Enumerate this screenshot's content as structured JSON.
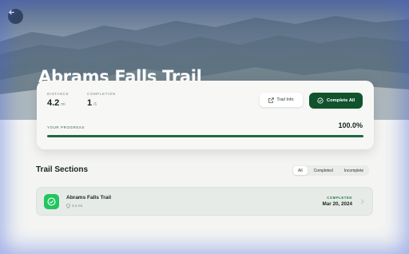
{
  "hero": {
    "title": "Abrams Falls Trail"
  },
  "stats": {
    "distance_label": "DISTANCE",
    "distance_value": "4.2",
    "distance_unit": "mi",
    "completion_label": "COMPLETION",
    "completion_value": "1",
    "completion_total": "/1"
  },
  "actions": {
    "trail_info_label": "Trail Info",
    "complete_all_label": "Complete All"
  },
  "progress": {
    "label": "YOUR PROGRESS",
    "value_text": "100.0%",
    "fraction": 1.0
  },
  "sections": {
    "title": "Trail Sections",
    "filters": [
      "All",
      "Completed",
      "Incomplete"
    ],
    "active_filter": "All",
    "items": [
      {
        "name": "Abrams Falls Trail",
        "distance": "4.2 mi",
        "status": "COMPLETED",
        "date": "Mar 20, 2024"
      }
    ]
  },
  "colors": {
    "primary": "#11532c",
    "accent_green": "#22c55e",
    "progress_fill": "#1d6b3c"
  },
  "icons": {
    "back": "arrow-left-icon",
    "trail_info": "external-link-icon",
    "complete_all": "check-circle-icon",
    "section": "check-circle-icon",
    "distance": "location-pin-icon",
    "row_chevron": "chevron-right-icon"
  }
}
